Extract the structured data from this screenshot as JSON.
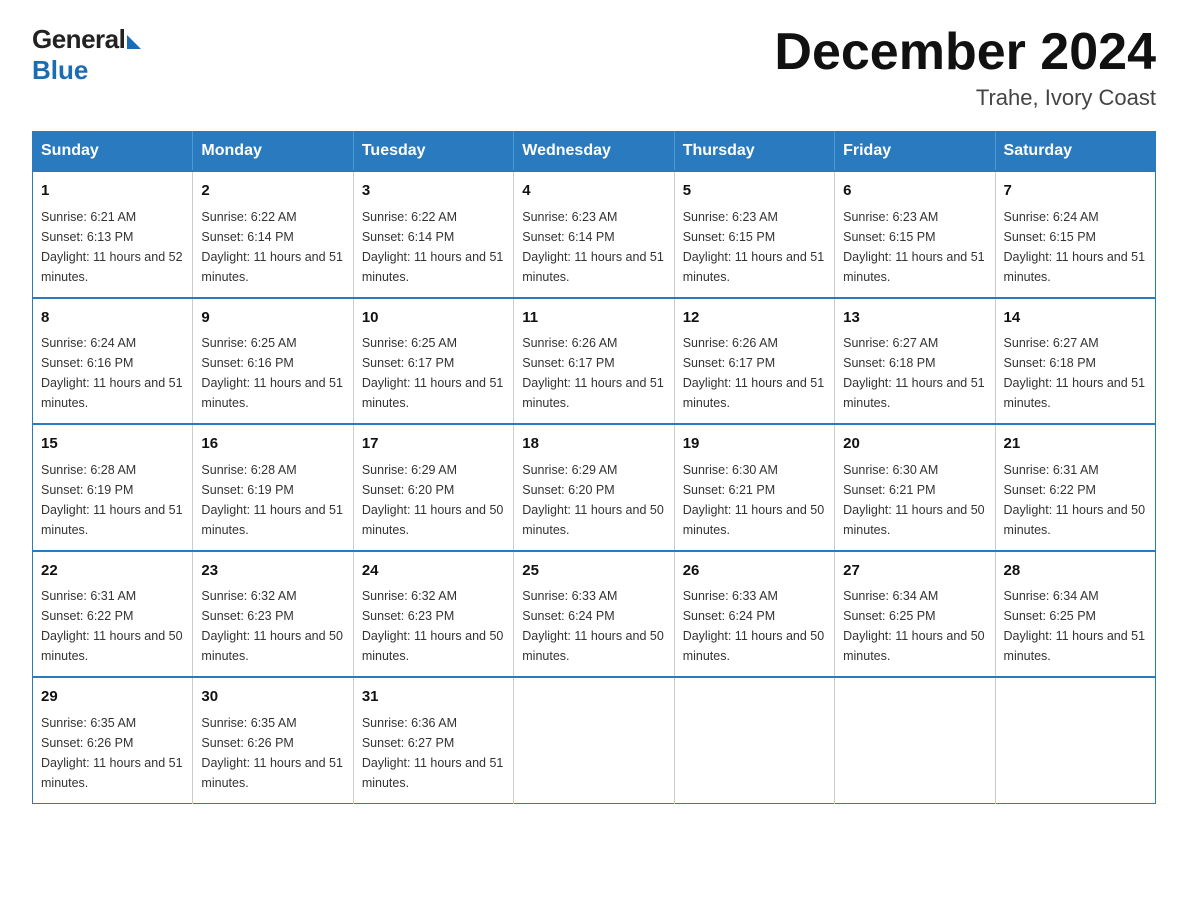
{
  "header": {
    "logo_general": "General",
    "logo_blue": "Blue",
    "month_title": "December 2024",
    "location": "Trahe, Ivory Coast"
  },
  "days_of_week": [
    "Sunday",
    "Monday",
    "Tuesday",
    "Wednesday",
    "Thursday",
    "Friday",
    "Saturday"
  ],
  "weeks": [
    [
      {
        "day": "1",
        "sunrise": "6:21 AM",
        "sunset": "6:13 PM",
        "daylight": "11 hours and 52 minutes."
      },
      {
        "day": "2",
        "sunrise": "6:22 AM",
        "sunset": "6:14 PM",
        "daylight": "11 hours and 51 minutes."
      },
      {
        "day": "3",
        "sunrise": "6:22 AM",
        "sunset": "6:14 PM",
        "daylight": "11 hours and 51 minutes."
      },
      {
        "day": "4",
        "sunrise": "6:23 AM",
        "sunset": "6:14 PM",
        "daylight": "11 hours and 51 minutes."
      },
      {
        "day": "5",
        "sunrise": "6:23 AM",
        "sunset": "6:15 PM",
        "daylight": "11 hours and 51 minutes."
      },
      {
        "day": "6",
        "sunrise": "6:23 AM",
        "sunset": "6:15 PM",
        "daylight": "11 hours and 51 minutes."
      },
      {
        "day": "7",
        "sunrise": "6:24 AM",
        "sunset": "6:15 PM",
        "daylight": "11 hours and 51 minutes."
      }
    ],
    [
      {
        "day": "8",
        "sunrise": "6:24 AM",
        "sunset": "6:16 PM",
        "daylight": "11 hours and 51 minutes."
      },
      {
        "day": "9",
        "sunrise": "6:25 AM",
        "sunset": "6:16 PM",
        "daylight": "11 hours and 51 minutes."
      },
      {
        "day": "10",
        "sunrise": "6:25 AM",
        "sunset": "6:17 PM",
        "daylight": "11 hours and 51 minutes."
      },
      {
        "day": "11",
        "sunrise": "6:26 AM",
        "sunset": "6:17 PM",
        "daylight": "11 hours and 51 minutes."
      },
      {
        "day": "12",
        "sunrise": "6:26 AM",
        "sunset": "6:17 PM",
        "daylight": "11 hours and 51 minutes."
      },
      {
        "day": "13",
        "sunrise": "6:27 AM",
        "sunset": "6:18 PM",
        "daylight": "11 hours and 51 minutes."
      },
      {
        "day": "14",
        "sunrise": "6:27 AM",
        "sunset": "6:18 PM",
        "daylight": "11 hours and 51 minutes."
      }
    ],
    [
      {
        "day": "15",
        "sunrise": "6:28 AM",
        "sunset": "6:19 PM",
        "daylight": "11 hours and 51 minutes."
      },
      {
        "day": "16",
        "sunrise": "6:28 AM",
        "sunset": "6:19 PM",
        "daylight": "11 hours and 51 minutes."
      },
      {
        "day": "17",
        "sunrise": "6:29 AM",
        "sunset": "6:20 PM",
        "daylight": "11 hours and 50 minutes."
      },
      {
        "day": "18",
        "sunrise": "6:29 AM",
        "sunset": "6:20 PM",
        "daylight": "11 hours and 50 minutes."
      },
      {
        "day": "19",
        "sunrise": "6:30 AM",
        "sunset": "6:21 PM",
        "daylight": "11 hours and 50 minutes."
      },
      {
        "day": "20",
        "sunrise": "6:30 AM",
        "sunset": "6:21 PM",
        "daylight": "11 hours and 50 minutes."
      },
      {
        "day": "21",
        "sunrise": "6:31 AM",
        "sunset": "6:22 PM",
        "daylight": "11 hours and 50 minutes."
      }
    ],
    [
      {
        "day": "22",
        "sunrise": "6:31 AM",
        "sunset": "6:22 PM",
        "daylight": "11 hours and 50 minutes."
      },
      {
        "day": "23",
        "sunrise": "6:32 AM",
        "sunset": "6:23 PM",
        "daylight": "11 hours and 50 minutes."
      },
      {
        "day": "24",
        "sunrise": "6:32 AM",
        "sunset": "6:23 PM",
        "daylight": "11 hours and 50 minutes."
      },
      {
        "day": "25",
        "sunrise": "6:33 AM",
        "sunset": "6:24 PM",
        "daylight": "11 hours and 50 minutes."
      },
      {
        "day": "26",
        "sunrise": "6:33 AM",
        "sunset": "6:24 PM",
        "daylight": "11 hours and 50 minutes."
      },
      {
        "day": "27",
        "sunrise": "6:34 AM",
        "sunset": "6:25 PM",
        "daylight": "11 hours and 50 minutes."
      },
      {
        "day": "28",
        "sunrise": "6:34 AM",
        "sunset": "6:25 PM",
        "daylight": "11 hours and 51 minutes."
      }
    ],
    [
      {
        "day": "29",
        "sunrise": "6:35 AM",
        "sunset": "6:26 PM",
        "daylight": "11 hours and 51 minutes."
      },
      {
        "day": "30",
        "sunrise": "6:35 AM",
        "sunset": "6:26 PM",
        "daylight": "11 hours and 51 minutes."
      },
      {
        "day": "31",
        "sunrise": "6:36 AM",
        "sunset": "6:27 PM",
        "daylight": "11 hours and 51 minutes."
      },
      null,
      null,
      null,
      null
    ]
  ]
}
